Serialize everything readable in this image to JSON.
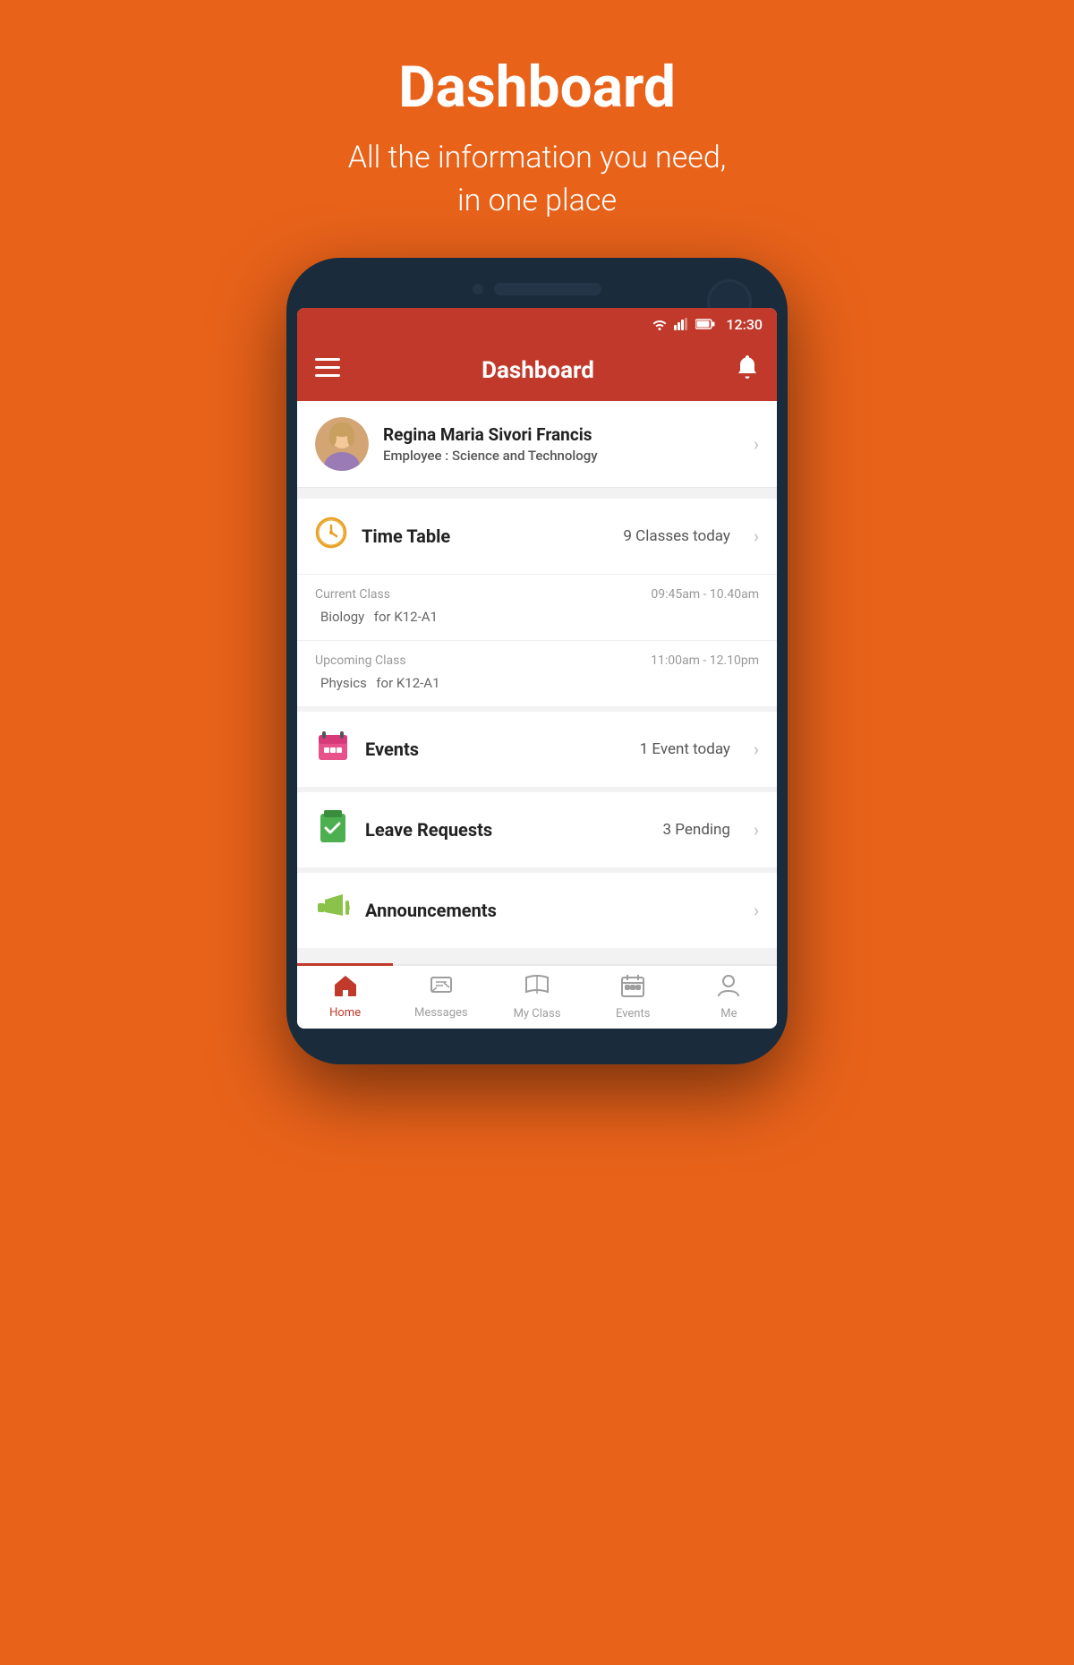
{
  "page": {
    "title": "Dashboard",
    "subtitle_line1": "All the information you need,",
    "subtitle_line2": "in one place"
  },
  "status_bar": {
    "time": "12:30"
  },
  "app_bar": {
    "title": "Dashboard"
  },
  "profile": {
    "name": "Regina Maria Sivori Francis",
    "role_label": "Employee :",
    "role_value": "Science and Technology"
  },
  "timetable": {
    "label": "Time Table",
    "count": "9 Classes today",
    "current_class": {
      "type": "Current Class",
      "time": "09:45am - 10.40am",
      "subject": "Biology",
      "class_name": "for K12-A1"
    },
    "upcoming_class": {
      "type": "Upcoming Class",
      "time": "11:00am - 12.10pm",
      "subject": "Physics",
      "class_name": "for K12-A1"
    }
  },
  "events": {
    "label": "Events",
    "count": "1 Event today"
  },
  "leave_requests": {
    "label": "Leave Requests",
    "count": "3 Pending"
  },
  "announcements": {
    "label": "Announcements",
    "count": ""
  },
  "bottom_nav": {
    "items": [
      {
        "id": "home",
        "label": "Home",
        "active": true
      },
      {
        "id": "messages",
        "label": "Messages",
        "active": false
      },
      {
        "id": "my-class",
        "label": "My Class",
        "active": false
      },
      {
        "id": "events",
        "label": "Events",
        "active": false
      },
      {
        "id": "me",
        "label": "Me",
        "active": false
      }
    ]
  }
}
